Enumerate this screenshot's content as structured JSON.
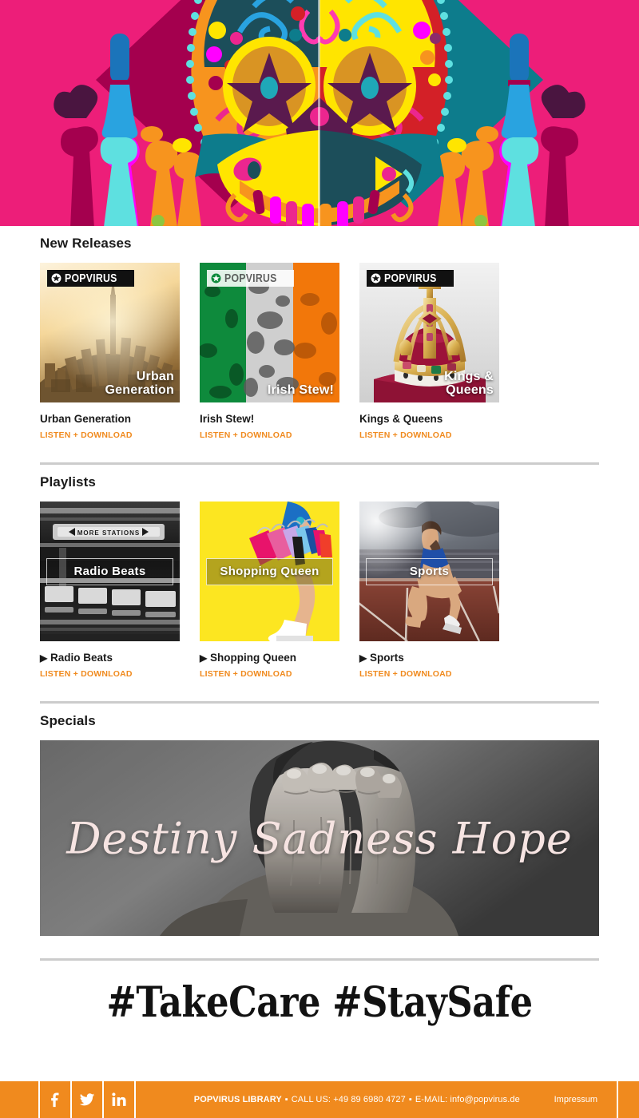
{
  "hero": {
    "alt": "day-of-the-dead sugar skull illustration",
    "background_color": "#ED1E79",
    "accent_colors": [
      "#ED1E79",
      "#A4004E",
      "#FFE500",
      "#00A3B4",
      "#F7941E",
      "#FF00FF",
      "#5EE0E0",
      "#0C5C7A",
      "#2B2B4E"
    ]
  },
  "sections": {
    "new_releases": {
      "title": "New Releases",
      "items": [
        {
          "title": "Urban Generation",
          "cover_caption_line1": "Urban",
          "cover_caption_line2": "Generation",
          "link_label": "LISTEN + DOWNLOAD",
          "logo": "POPVIRUS",
          "logo_style": "dark"
        },
        {
          "title": "Irish Stew!",
          "cover_caption_line1": "Irish Stew!",
          "cover_caption_line2": "",
          "link_label": "LISTEN + DOWNLOAD",
          "logo": "POPVIRUS",
          "logo_style": "ghost"
        },
        {
          "title": "Kings & Queens",
          "cover_caption_line1": "Kings &",
          "cover_caption_line2": "Queens",
          "link_label": "LISTEN + DOWNLOAD",
          "logo": "POPVIRUS",
          "logo_style": "dark"
        }
      ]
    },
    "playlists": {
      "title": "Playlists",
      "items": [
        {
          "title": "Radio Beats",
          "play_glyph": "▶",
          "band_label": "Radio Beats",
          "link_label": "LISTEN + DOWNLOAD"
        },
        {
          "title": "Shopping Queen",
          "play_glyph": "▶",
          "band_label": "Shopping Queen",
          "link_label": "LISTEN + DOWNLOAD"
        },
        {
          "title": "Sports",
          "play_glyph": "▶",
          "band_label": "Sports",
          "link_label": "LISTEN + DOWNLOAD"
        }
      ]
    },
    "specials": {
      "title": "Specials",
      "banner_text": "Destiny Sadness Hope",
      "banner_alt": "black and white photo of a man covering his face with his hands"
    }
  },
  "hashtag": "#TakeCare #StaySafe",
  "footer": {
    "background_color": "#F08A1E",
    "social": [
      {
        "name": "facebook",
        "glyph": "f"
      },
      {
        "name": "twitter",
        "glyph": "ᵗ"
      },
      {
        "name": "linkedin",
        "glyph": "in"
      }
    ],
    "brand": "POPVIRUS LIBRARY",
    "sep1": "▪",
    "phone": "CALL US: +49 89 6980 4727",
    "sep2": "▪",
    "email": "E-MAIL: info@popvirus.de",
    "impressum": "Impressum"
  },
  "colors": {
    "accent_orange": "#F08A1E",
    "divider_gray": "#cccccc",
    "text_dark": "#1a1a1a"
  }
}
